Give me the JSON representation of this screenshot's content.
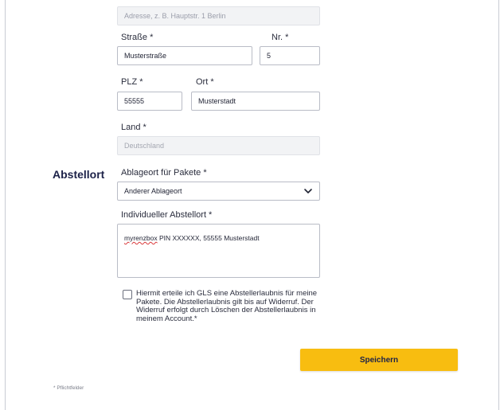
{
  "address": {
    "search_placeholder": "Adresse, z. B. Hauptstr. 1 Berlin",
    "street_label": "Straße *",
    "street_value": "Musterstraße",
    "number_label": "Nr. *",
    "number_value": "5",
    "zip_label": "PLZ *",
    "zip_value": "55555",
    "city_label": "Ort *",
    "city_value": "Musterstadt",
    "country_label": "Land *",
    "country_value": "Deutschland"
  },
  "drop_off": {
    "section_title": "Abstellort",
    "place_label": "Ablageort für Pakete *",
    "place_selected": "Anderer Ablageort",
    "custom_label": "Individueller Abstellort *",
    "custom_value_word1": "myrenzbox",
    "custom_value_rest": " PIN XXXXXX, 55555 Musterstadt",
    "consent_text": "Hiermit erteile ich GLS eine Abstellerlaubnis für meine Pakete. Die Abstellerlaubnis gilt bis auf Widerruf. Der Widerruf erfolgt durch Löschen der Abstellerlaubnis in meinem Account.*"
  },
  "actions": {
    "save_label": "Speichern"
  },
  "footer": {
    "required_note": "* Pflichtfelder"
  },
  "icons": {
    "select_arrow": "chevron-down-icon"
  }
}
